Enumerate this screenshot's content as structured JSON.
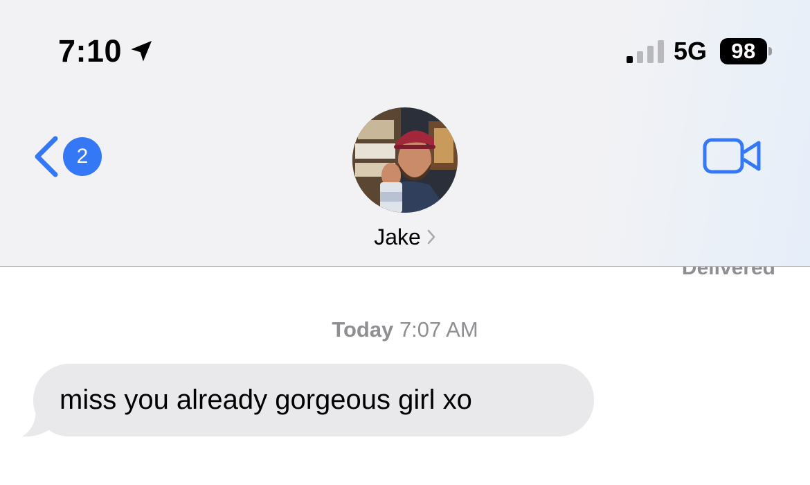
{
  "status_bar": {
    "time": "7:10",
    "location_icon": "location-arrow-icon",
    "signal_icon": "cellular-signal-icon",
    "network": "5G",
    "battery": "98"
  },
  "nav": {
    "back_icon": "chevron-left-icon",
    "unread_count": "2",
    "contact_name": "Jake",
    "contact_chevron_icon": "chevron-right-icon",
    "facetime_icon": "video-camera-icon",
    "accent_color": "#3478f6"
  },
  "conversation": {
    "delivered_label": "Delivered",
    "timestamp_day": "Today",
    "timestamp_time": "7:07 AM",
    "messages": [
      {
        "direction": "incoming",
        "text": "miss you already gorgeous girl xo"
      }
    ],
    "incoming_bubble_color": "#e9e9eb"
  }
}
